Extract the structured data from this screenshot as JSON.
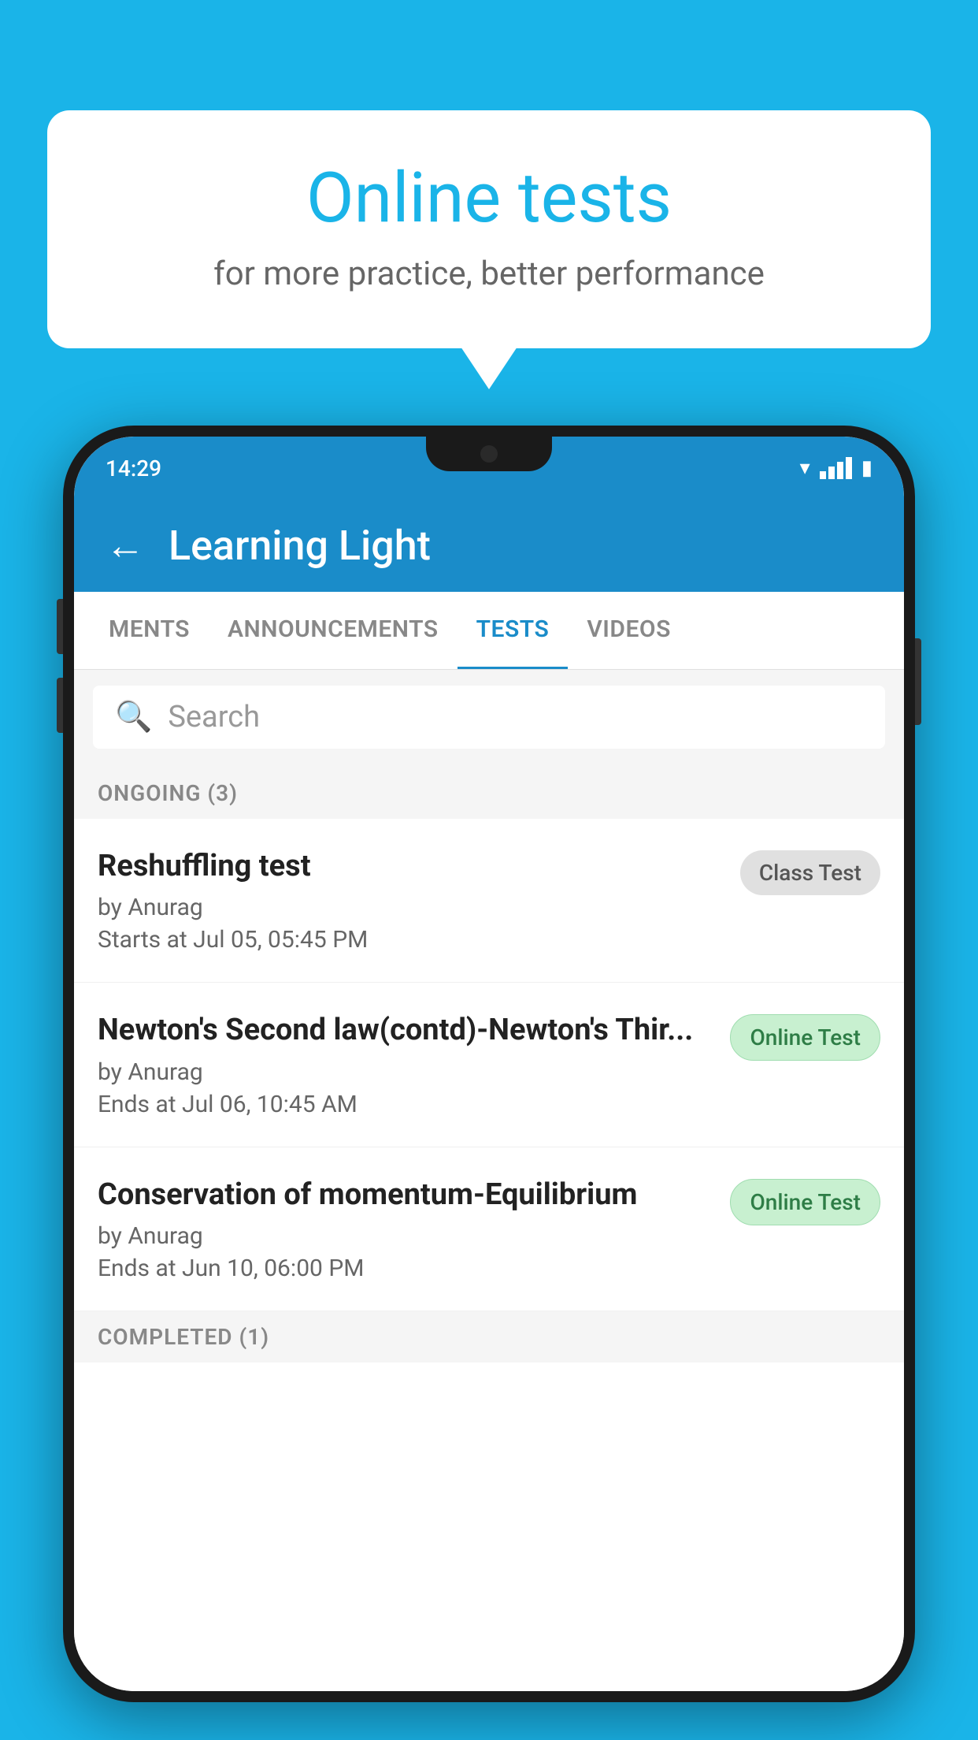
{
  "background": {
    "color": "#1ab4e8"
  },
  "speechBubble": {
    "title": "Online tests",
    "subtitle": "for more practice, better performance"
  },
  "phone": {
    "statusBar": {
      "time": "14:29",
      "icons": [
        "wifi",
        "signal",
        "battery"
      ]
    },
    "header": {
      "backLabel": "←",
      "title": "Learning Light"
    },
    "tabs": [
      {
        "label": "MENTS",
        "active": false
      },
      {
        "label": "ANNOUNCEMENTS",
        "active": false
      },
      {
        "label": "TESTS",
        "active": true
      },
      {
        "label": "VIDEOS",
        "active": false
      }
    ],
    "search": {
      "placeholder": "Search"
    },
    "sections": [
      {
        "title": "ONGOING (3)",
        "tests": [
          {
            "name": "Reshuffling test",
            "author": "by Anurag",
            "time": "Starts at  Jul 05, 05:45 PM",
            "badge": "Class Test",
            "badgeType": "gray"
          },
          {
            "name": "Newton's Second law(contd)-Newton's Thir...",
            "author": "by Anurag",
            "time": "Ends at  Jul 06, 10:45 AM",
            "badge": "Online Test",
            "badgeType": "green"
          },
          {
            "name": "Conservation of momentum-Equilibrium",
            "author": "by Anurag",
            "time": "Ends at  Jun 10, 06:00 PM",
            "badge": "Online Test",
            "badgeType": "green"
          }
        ]
      },
      {
        "title": "COMPLETED (1)",
        "tests": []
      }
    ]
  }
}
